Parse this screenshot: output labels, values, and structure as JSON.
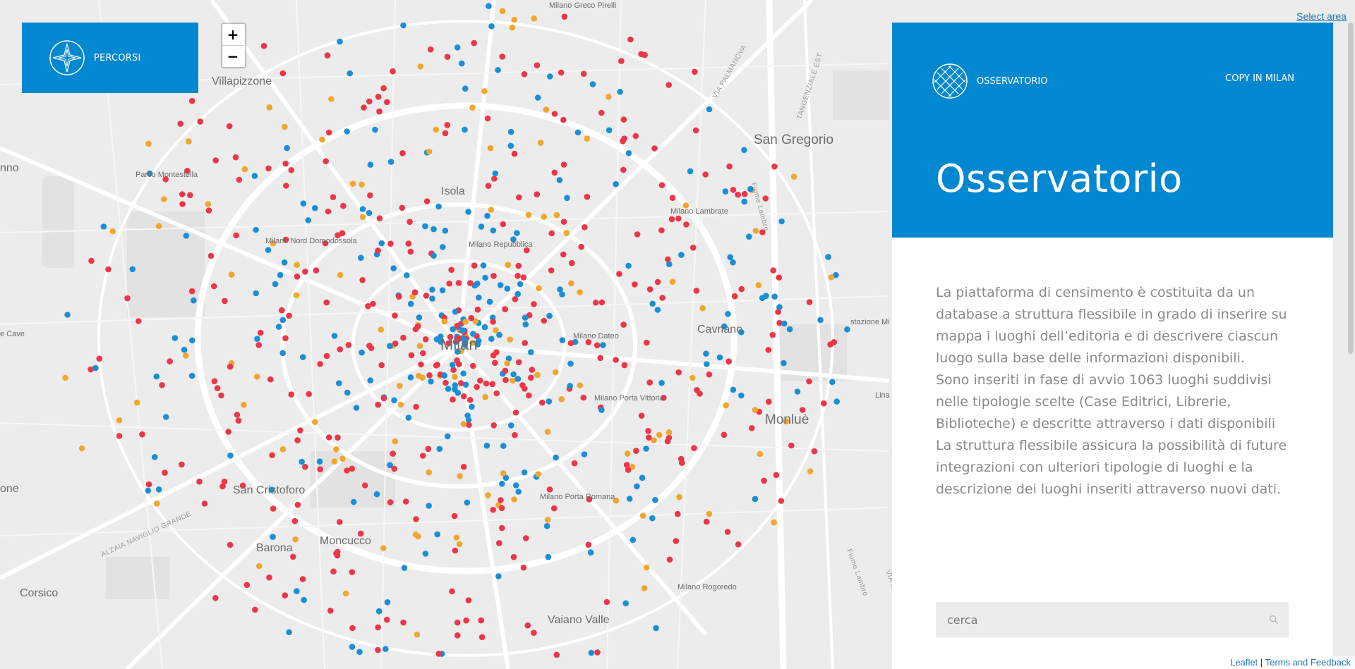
{
  "map": {
    "places": [
      {
        "name": "Milano Greco Pirelli",
        "cls": "s"
      },
      {
        "name": "Villapizzone",
        "cls": "m"
      },
      {
        "name": "Parco Montestella",
        "cls": "s"
      },
      {
        "name": "nno",
        "cls": "m"
      },
      {
        "name": "Isola",
        "cls": "m"
      },
      {
        "name": "Milano Nord Domodossola",
        "cls": "s"
      },
      {
        "name": "Milano Repubblica",
        "cls": "s"
      },
      {
        "name": "Milano Lambrate",
        "cls": "s"
      },
      {
        "name": "San Gregorio",
        "cls": "l"
      },
      {
        "name": "Milan",
        "cls": "xl"
      },
      {
        "name": "Milano Dateo",
        "cls": "s"
      },
      {
        "name": "Cavriano",
        "cls": "m"
      },
      {
        "name": "Milano Porta Vittoria",
        "cls": "s"
      },
      {
        "name": "Monluè",
        "cls": "l"
      },
      {
        "name": "e Cave",
        "cls": "s"
      },
      {
        "name": "stazione Mi",
        "cls": "s"
      },
      {
        "name": "Lina",
        "cls": "s"
      },
      {
        "name": "San Cristoforo",
        "cls": "m"
      },
      {
        "name": "one",
        "cls": "m"
      },
      {
        "name": "Milano Porta Romana",
        "cls": "s"
      },
      {
        "name": "Barona",
        "cls": "m"
      },
      {
        "name": "Moncucco",
        "cls": "m"
      },
      {
        "name": "Corsico",
        "cls": "m"
      },
      {
        "name": "Milano Rogoredo",
        "cls": "s"
      },
      {
        "name": "Vaiano Valle",
        "cls": "m"
      }
    ],
    "roads": [
      "VIA PALMANOVA",
      "TANGENZIALE EST",
      "Fiume Lambro",
      "ALZAIA NAVIGLIO GRANDE",
      "Fiume Lambro",
      "VIA MILANO"
    ],
    "colors": {
      "librerie": "#ec3649",
      "biblioteche": "#1a8fd6",
      "case_editrici": "#f2a62e"
    }
  },
  "percorsi": {
    "label": "PERCORSI",
    "icon": "compass-icon"
  },
  "zoom": {
    "in": "+",
    "out": "−"
  },
  "select_area": "Select area",
  "panel": {
    "brand": "OSSERVATORIO",
    "brand_icon": "globe-grid-icon",
    "copy_link": "COPY IN MILAN",
    "title": "Osservatorio",
    "paragraphs": [
      "La piattaforma di censimento è costituita da un database a struttura flessibile in grado di inserire su mappa i luoghi dell’editoria e di descrivere ciascun luogo sulla base delle informazioni disponibili.",
      "Sono inseriti in fase di avvio 1063 luoghi suddivisi nelle tipologie scelte (Case Editrici, Librerie, Biblioteche) e descritte attraverso i dati disponibili",
      "La struttura flessibile assicura la possibilità di future integrazioni con ulteriori tipologie di luoghi e la descrizione dei luoghi inseriti attraverso nuovi dati."
    ],
    "search_placeholder": "cerca",
    "search_icon": "search-icon"
  },
  "attribution": {
    "leaflet": "Leaflet",
    "sep": "|",
    "terms": "Terms and Feedback"
  }
}
